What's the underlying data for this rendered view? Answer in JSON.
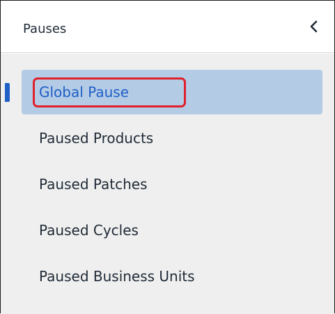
{
  "panel": {
    "title": "Pauses",
    "collapse_icon": "chevron-left-icon"
  },
  "nav": {
    "items": [
      {
        "label": "Global Pause",
        "selected": true
      },
      {
        "label": "Paused Products",
        "selected": false
      },
      {
        "label": "Paused Patches",
        "selected": false
      },
      {
        "label": "Paused Cycles",
        "selected": false
      },
      {
        "label": "Paused Business Units",
        "selected": false
      }
    ]
  },
  "colors": {
    "selected_bg": "#b4cbe6",
    "selected_text": "#1f5fc6",
    "panel_bg": "#efefef",
    "highlight_border": "#e0202a"
  }
}
